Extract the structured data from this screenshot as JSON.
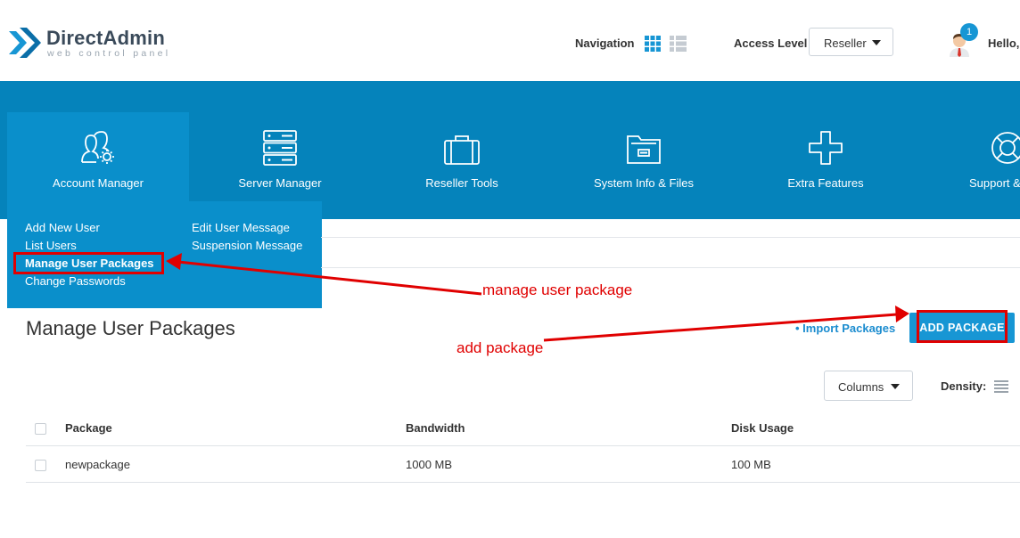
{
  "header": {
    "logo_title": "DirectAdmin",
    "logo_subtitle": "web control panel",
    "navigation_label": "Navigation",
    "access_level_label": "Access Level",
    "access_level_value": "Reseller",
    "notification_count": "1",
    "greeting": "Hello,"
  },
  "nav": {
    "items": [
      {
        "label": "Account Manager",
        "icon": "users-gear-icon"
      },
      {
        "label": "Server Manager",
        "icon": "server-icon"
      },
      {
        "label": "Reseller Tools",
        "icon": "briefcase-icon"
      },
      {
        "label": "System Info & Files",
        "icon": "folder-icon"
      },
      {
        "label": "Extra Features",
        "icon": "plus-icon"
      },
      {
        "label": "Support &",
        "icon": "lifebuoy-icon"
      }
    ]
  },
  "dropdown": {
    "left": [
      "Add New User",
      "List Users",
      "Manage User Packages",
      "Change Passwords"
    ],
    "right": [
      "Edit User Message",
      "Suspension Message"
    ]
  },
  "page": {
    "title": "Manage User Packages",
    "import_link": "• Import Packages",
    "add_button": "ADD PACKAGE",
    "columns_button": "Columns",
    "density_label": "Density:"
  },
  "table": {
    "headers": [
      "Package",
      "Bandwidth",
      "Disk Usage"
    ],
    "rows": [
      [
        "newpackage",
        "1000 MB",
        "100 MB"
      ]
    ]
  },
  "annotations": {
    "manage_label": "manage user package",
    "add_label": "add package",
    "color": "#e00000"
  },
  "colors": {
    "brand_blue": "#0583bb",
    "button_blue": "#1796d4",
    "link_blue": "#1b8ccf"
  }
}
